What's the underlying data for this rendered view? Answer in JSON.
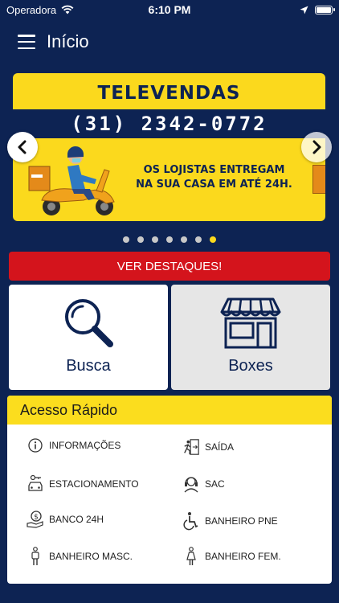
{
  "status_bar": {
    "carrier": "Operadora",
    "time": "6:10 PM",
    "battery_level": 1.0
  },
  "header": {
    "title": "Início",
    "menu_icon": "hamburger-menu-icon"
  },
  "banner": {
    "title": "TELEVENDAS",
    "phone": "(31) 2342-0772",
    "promo_line1": "OS LOJISTAS ENTREGAM",
    "promo_line2": "NA SUA CASA EM ATÉ 24H.",
    "active_slide": 7,
    "slide_count": 7
  },
  "highlights_button": "VER DESTAQUES!",
  "cards": {
    "search": "Busca",
    "boxes": "Boxes"
  },
  "quick_access": {
    "title": "Acesso Rápido",
    "items": [
      {
        "label": "INFORMAÇÕES",
        "icon": "info-icon"
      },
      {
        "label": "SAÍDA",
        "icon": "exit-icon"
      },
      {
        "label": "ESTACIONAMENTO",
        "icon": "car-icon"
      },
      {
        "label": "SAC",
        "icon": "headset-icon"
      },
      {
        "label": "BANCO 24H",
        "icon": "money-hand-icon"
      },
      {
        "label": "BANHEIRO PNE",
        "icon": "wheelchair-icon"
      },
      {
        "label": "BANHEIRO MASC.",
        "icon": "male-icon"
      },
      {
        "label": "BANHEIRO FEM.",
        "icon": "female-icon"
      }
    ]
  },
  "colors": {
    "background": "#0d2353",
    "accent_yellow": "#fbd91d",
    "button_red": "#d4141c"
  }
}
